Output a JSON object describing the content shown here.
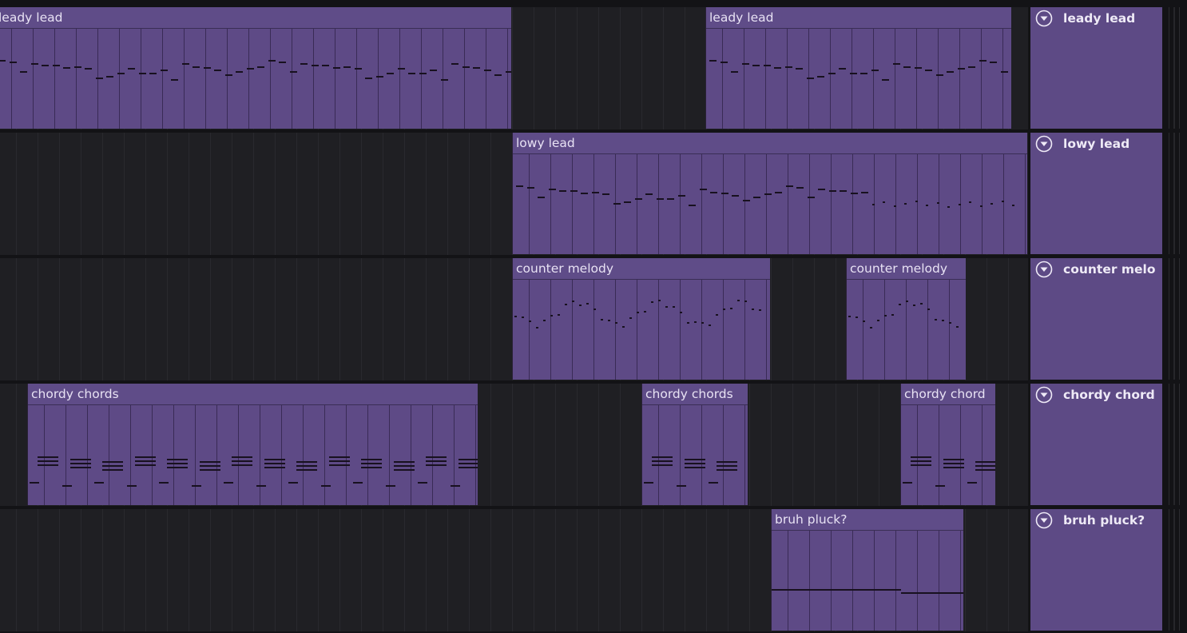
{
  "tracks": [
    {
      "name": "leady lead",
      "clips": [
        {
          "label": "leady lead",
          "start": -7,
          "end": 640
        },
        {
          "label": "leady lead",
          "start": 883,
          "end": 1266
        }
      ]
    },
    {
      "name": "lowy lead",
      "clips": [
        {
          "label": "lowy lead",
          "start": 641,
          "end": 1286
        }
      ]
    },
    {
      "name": "counter melo",
      "clips": [
        {
          "label": "counter melody",
          "start": 641,
          "end": 964
        },
        {
          "label": "counter melody",
          "start": 1059,
          "end": 1209
        }
      ]
    },
    {
      "name": "chordy chord",
      "clips": [
        {
          "label": "chordy chords",
          "start": 34,
          "end": 598
        },
        {
          "label": "chordy chords",
          "start": 803,
          "end": 936
        },
        {
          "label": "chordy chord",
          "start": 1127,
          "end": 1246
        }
      ]
    },
    {
      "name": "bruh pluck?",
      "clips": [
        {
          "label": "bruh pluck?",
          "start": 965,
          "end": 1206
        }
      ]
    }
  ],
  "icons": {
    "fold": "fold-circle-chevron-down-icon"
  },
  "colors": {
    "clip": "#5e4a86",
    "track_header": "#5d4a85",
    "background": "#1f1f23",
    "note": "#18111f"
  }
}
